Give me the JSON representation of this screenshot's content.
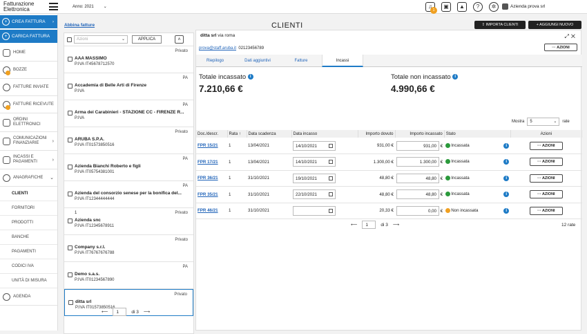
{
  "app": {
    "logo_line1": "Fatturazione",
    "logo_line2": "Elettronica",
    "year_label": "Anno: 2021",
    "notification_count": "1",
    "user_name": "Azienda prova srl"
  },
  "sidebar": {
    "crea_fattura": "CREA FATTURA",
    "carica_fattura": "CARICA FATTURA",
    "items": [
      {
        "label": "HOME"
      },
      {
        "label": "BOZZE"
      },
      {
        "label": "FATTURE INVIATE"
      },
      {
        "label": "FATTURE RICEVUTE"
      },
      {
        "label": "ORDINI ELETTRONICI"
      },
      {
        "label": "COMUNICAZIONI FINANZIARIE"
      },
      {
        "label": "INCASSI E PAGAMENTI"
      },
      {
        "label": "ANAGRAFICHE"
      }
    ],
    "subitems": [
      "CLIENTI",
      "FORNITORI",
      "PRODOTTI",
      "BANCHE",
      "PAGAMENTI",
      "CODICI IVA",
      "UNITÀ DI MISURA"
    ],
    "agenda": "AGENDA"
  },
  "list": {
    "abbina_link": "Abbina fatture",
    "filter_placeholder": "Azioni",
    "applica_label": "APPLICA",
    "items": [
      {
        "type": "Privato",
        "number": "",
        "name": "AAA MASSIMO",
        "piva": "P.IVA  IT45678712570"
      },
      {
        "type": "PA",
        "number": "",
        "name": "Accademia di Belle Arti di Firenze",
        "piva": "P.IVA"
      },
      {
        "type": "PA",
        "number": "",
        "name": "Arma dei Carabinieri - STAZIONE CC - FIRENZE R...",
        "piva": "P.IVA"
      },
      {
        "type": "Privato",
        "number": "",
        "name": "ARUBA S.P.A.",
        "piva": "P.IVA  IT01573850516"
      },
      {
        "type": "PA",
        "number": "",
        "name": "Azienda Bianchi Roberto e figli",
        "piva": "P.IVA  IT05754381001"
      },
      {
        "type": "PA",
        "number": "",
        "name": "Azienda del consorzio senese per la bonifica del...",
        "piva": "P.IVA  IT12344444444"
      },
      {
        "type": "Privato",
        "number": "1",
        "name": "Azienda snc",
        "piva": "P.IVA  IT12345678911"
      },
      {
        "type": "Privato",
        "number": "",
        "name": "Company s.r.l.",
        "piva": "P.IVA  IT76767676788"
      },
      {
        "type": "PA",
        "number": "",
        "name": "Demo s.a.s.",
        "piva": "P.IVA  IT01234567890"
      },
      {
        "type": "Privato",
        "number": "",
        "name": "ditta srl",
        "piva": "P.IVA  IT01573850516"
      }
    ],
    "page": "1",
    "total_pages": "di 3"
  },
  "main": {
    "title": "CLIENTI",
    "importa_label": "IMPORTA CLIENTI",
    "aggiungi_label": "AGGIUNGI NUOVO",
    "client_name": "ditta srl",
    "client_address": "via roma",
    "client_email": "prova@staff.aruba.it",
    "client_phone": "02123456789",
    "azioni_label": "AZIONI",
    "tabs": [
      "Riepilogo",
      "Dati aggiuntivi",
      "Fatture",
      "Incassi"
    ],
    "totale_incassato_label": "Totale incassato",
    "totale_incassato_value": "7.210,66 €",
    "totale_non_incassato_label": "Totale non incassato",
    "totale_non_incassato_value": "4.990,66 €",
    "mostra_label": "Mostra",
    "mostra_value": "5",
    "mostra_suffix": "rate",
    "columns": [
      "Doc./descr.",
      "Rata",
      "Data scadenza",
      "Data incasso",
      "Importo dovuto",
      "Importo incassato",
      "Stato",
      "Azioni"
    ],
    "rows": [
      {
        "doc": "FPR 15/21",
        "rata": "1",
        "scadenza": "13/04/2021",
        "incasso": "14/10/2021",
        "dovuto": "931,00 €",
        "incassato": "931,00",
        "stato": "Incassata",
        "ok": true
      },
      {
        "doc": "FPR 17/21",
        "rata": "1",
        "scadenza": "13/04/2021",
        "incasso": "14/10/2021",
        "dovuto": "1.300,00 €",
        "incassato": "1.300,00",
        "stato": "Incassata",
        "ok": true
      },
      {
        "doc": "FPR 36/21",
        "rata": "1",
        "scadenza": "31/10/2021",
        "incasso": "19/10/2021",
        "dovuto": "48,80 €",
        "incassato": "48,80",
        "stato": "Incassata",
        "ok": true
      },
      {
        "doc": "FPR 35/21",
        "rata": "1",
        "scadenza": "31/10/2021",
        "incasso": "22/10/2021",
        "dovuto": "48,80 €",
        "incassato": "48,80",
        "stato": "Incassata",
        "ok": true
      },
      {
        "doc": "FPR 46/21",
        "rata": "1",
        "scadenza": "31/10/2021",
        "incasso": "",
        "dovuto": "20,33 €",
        "incassato": "0,00",
        "stato": "Non incassata",
        "ok": false
      }
    ],
    "currency": "€",
    "page": "1",
    "total_pages": "di 3",
    "rate_count": "12 rate"
  }
}
